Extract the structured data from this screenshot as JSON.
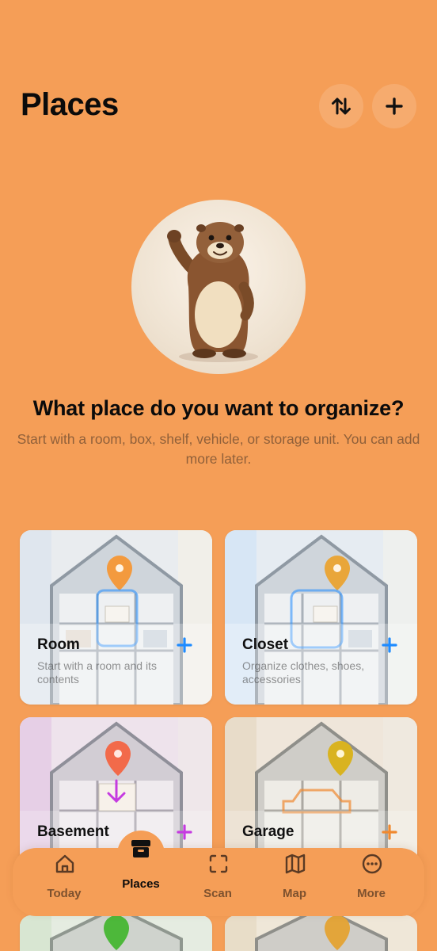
{
  "header": {
    "title": "Places",
    "sort_icon": "sort-arrows-icon",
    "add_icon": "plus-icon"
  },
  "hero": {
    "mascot": "marmot-waving-illustration"
  },
  "onboarding": {
    "question": "What place do you want to organize?",
    "subtitle": "Start with a room, box, shelf, vehicle, or storage unit. You can add more later."
  },
  "place_types": [
    {
      "title": "Room",
      "description": "Start with a room and its contents",
      "accent": "#1E8BFF",
      "tint": "#E9F2FA"
    },
    {
      "title": "Closet",
      "description": "Organize clothes, shoes, accessories",
      "accent": "#1E8BFF",
      "tint": "#E7F1FB"
    },
    {
      "title": "Basement",
      "description": "",
      "accent": "#C53BE0",
      "tint": "#F1E2F1"
    },
    {
      "title": "Garage",
      "description": "",
      "accent": "#F0892F",
      "tint": "#F3E8D9"
    }
  ],
  "tabbar": {
    "items": [
      {
        "label": "Today",
        "icon": "home-icon"
      },
      {
        "label": "Places",
        "icon": "archive-box-icon"
      },
      {
        "label": "Scan",
        "icon": "scan-frame-icon"
      },
      {
        "label": "Map",
        "icon": "map-icon"
      },
      {
        "label": "More",
        "icon": "more-dots-icon"
      }
    ],
    "active": "Places"
  },
  "colors": {
    "background": "#F59E57",
    "text": "#0B0B0B"
  }
}
